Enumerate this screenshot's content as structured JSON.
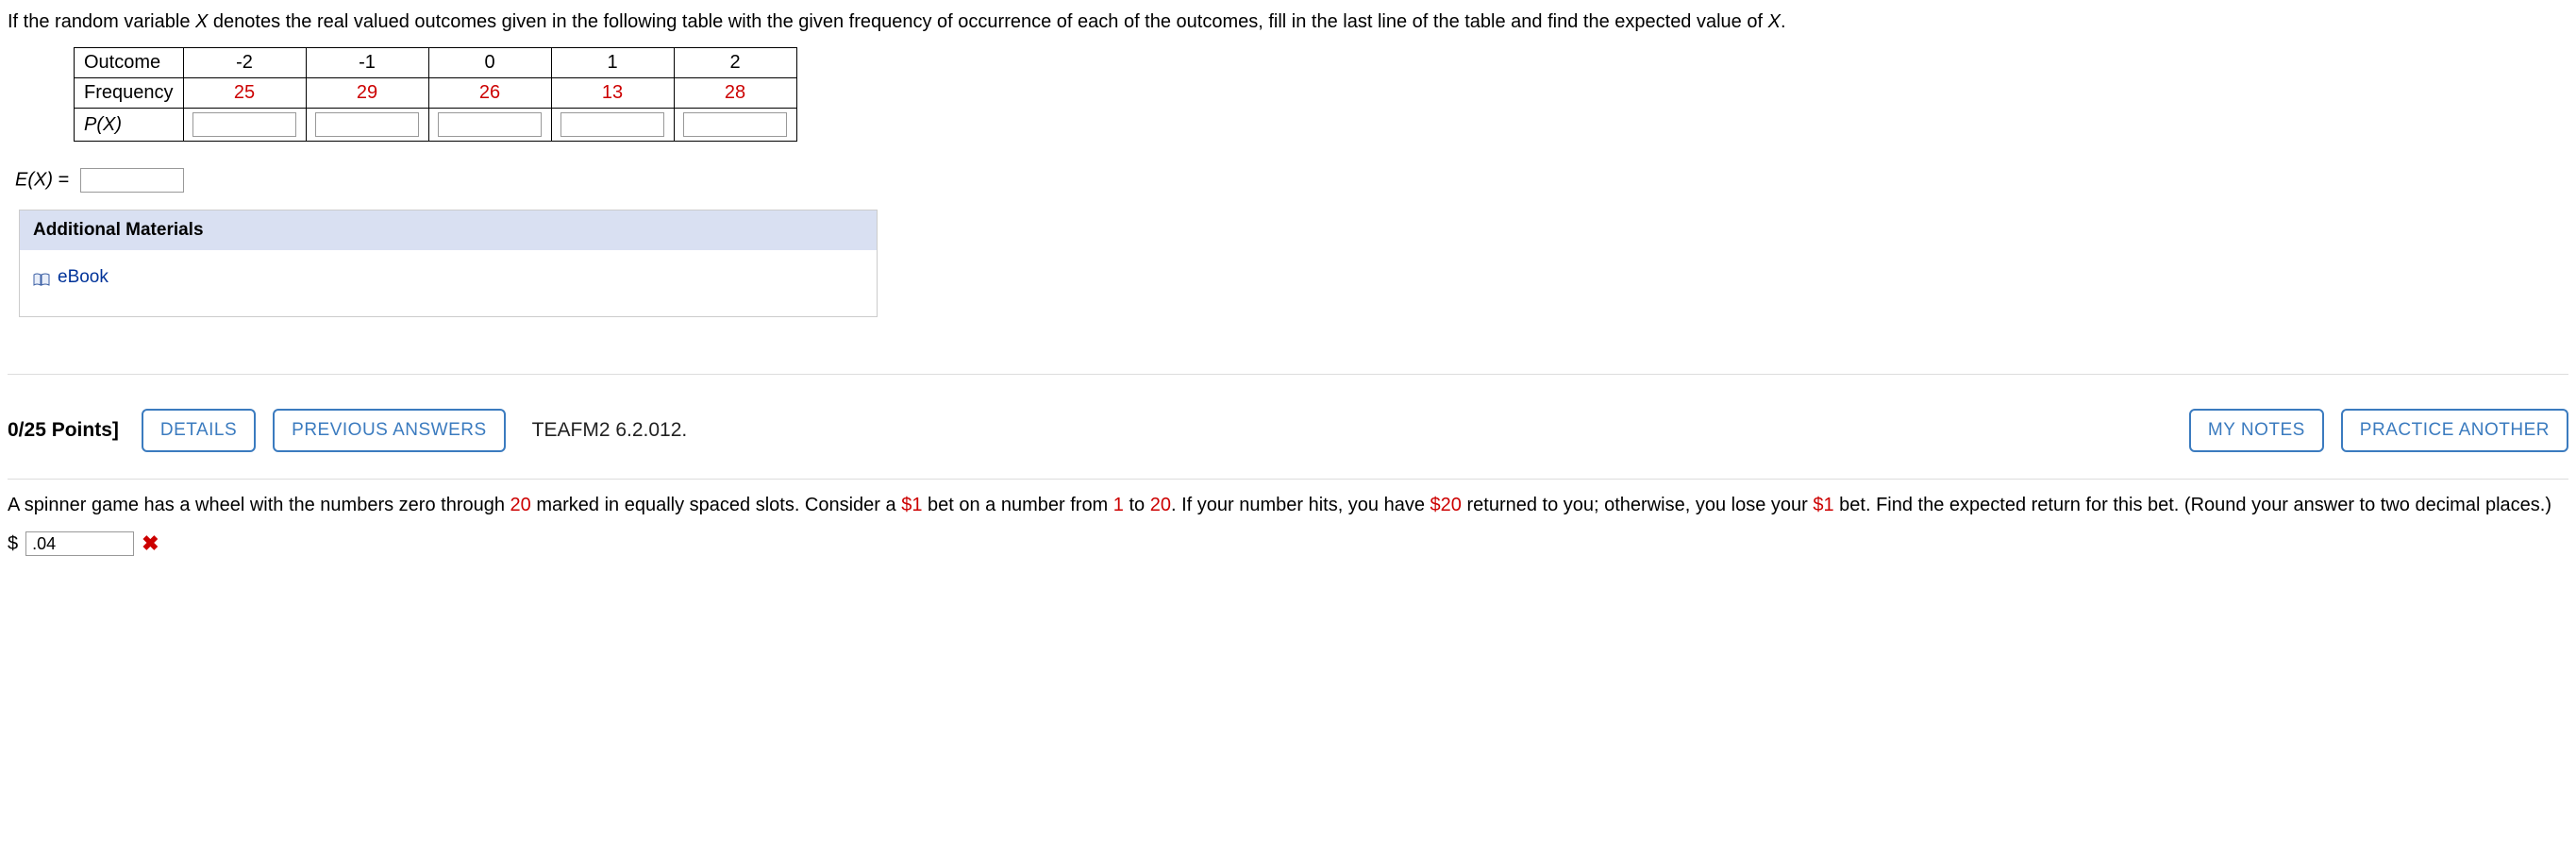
{
  "q1": {
    "prompt_a": "If the random variable ",
    "var_X": "X",
    "prompt_b": " denotes the real valued outcomes given in the following table with the given frequency of occurrence of each of the outcomes, fill in the last line of the table and find the expected value of ",
    "var_X2": "X",
    "prompt_c": ".",
    "row_labels": {
      "outcome": "Outcome",
      "frequency": "Frequency",
      "px": "P(X)"
    },
    "outcomes": [
      "-2",
      "-1",
      "0",
      "1",
      "2"
    ],
    "frequencies": [
      "25",
      "29",
      "26",
      "13",
      "28"
    ],
    "ex_label_a": "E",
    "ex_label_b": "(X)",
    "ex_label_c": " = "
  },
  "additional": {
    "header": "Additional Materials",
    "ebook": "eBook"
  },
  "nav": {
    "points": "0/25 Points]",
    "details": "DETAILS",
    "previous": "PREVIOUS ANSWERS",
    "ref": "TEAFM2 6.2.012.",
    "mynotes": "MY NOTES",
    "practice": "PRACTICE ANOTHER"
  },
  "q2": {
    "text_a": "A spinner game has a wheel with the numbers zero through ",
    "n20_a": "20",
    "text_b": " marked in equally spaced slots. Consider a ",
    "bet": "$1",
    "text_c": " bet on a number from ",
    "one": "1",
    "text_d": " to ",
    "n20_b": "20",
    "text_e": ". If your number hits, you have ",
    "ret": "$20",
    "text_f": " returned to you; otherwise, you lose your ",
    "bet2": "$1",
    "text_g": " bet. Find the expected return for this bet. (Round your answer to two decimal places.)",
    "dollar": "$",
    "answer_value": ".04"
  }
}
